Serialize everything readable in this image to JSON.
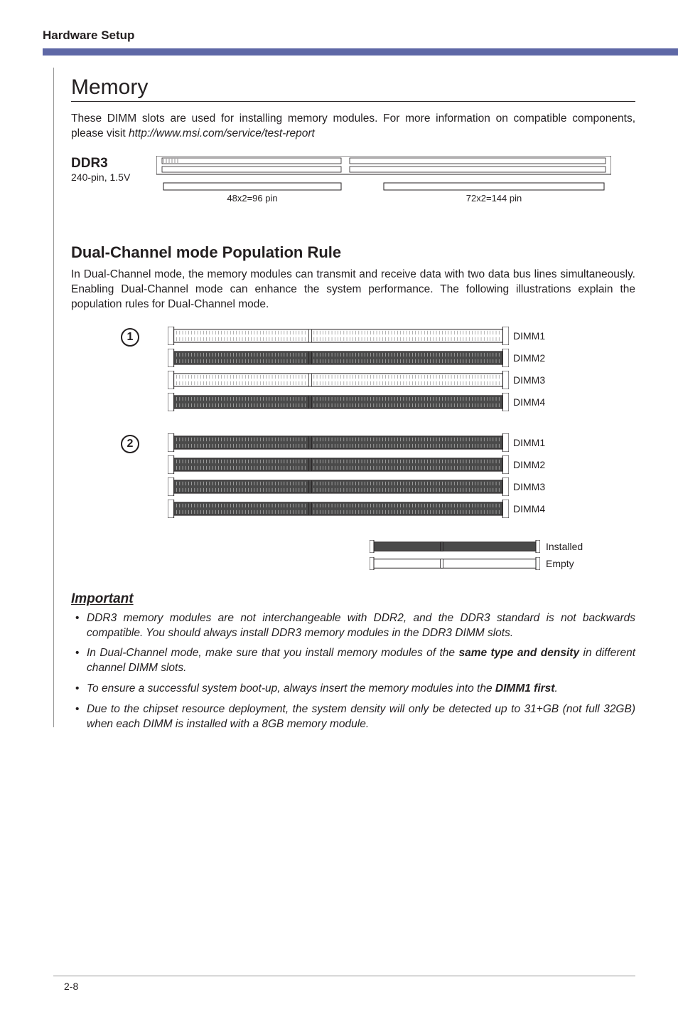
{
  "header": {
    "title": "Hardware Setup"
  },
  "memory": {
    "title": "Memory",
    "intro_a": "These DIMM slots are used for installing memory modules. For more information on compatible components, please visit ",
    "intro_b": "http://www.msi.com/service/test-report",
    "ddr3_title": "DDR3",
    "ddr3_sub": "240-pin, 1.5V",
    "pin_left": "48x2=96 pin",
    "pin_right": "72x2=144  pin"
  },
  "dual": {
    "title": "Dual-Channel mode Population Rule",
    "text": "In Dual-Channel mode, the memory modules can transmit and receive data with two data bus lines simultaneously. Enabling Dual-Channel mode can enhance the system performance. The following illustrations explain the population rules for Dual-Channel mode.",
    "cfg1": "1",
    "cfg2": "2",
    "dimm1": "DIMM1",
    "dimm2": "DIMM2",
    "dimm3": "DIMM3",
    "dimm4": "DIMM4"
  },
  "legend": {
    "installed": "Installed",
    "empty": "Empty"
  },
  "important": {
    "title": "Important",
    "b1": "DDR3 memory modules are not interchangeable with DDR2, and the DDR3 standard is not backwards compatible. You should always install DDR3 memory modules in the DDR3 DIMM slots.",
    "b2_a": "In Dual-Channel mode, make sure that you install memory modules of the ",
    "b2_b": "same type and density",
    "b2_c": " in different channel DIMM slots.",
    "b3_a": "To ensure a successful system boot-up, always insert the memory modules into the ",
    "b3_b": "DIMM1 first",
    "b3_c": ".",
    "b4": "Due to the chipset resource deployment, the system density will only be detected up to 31+GB (not full 32GB) when each DIMM is installed with a 8GB memory module."
  },
  "footer": {
    "page": "2-8"
  }
}
